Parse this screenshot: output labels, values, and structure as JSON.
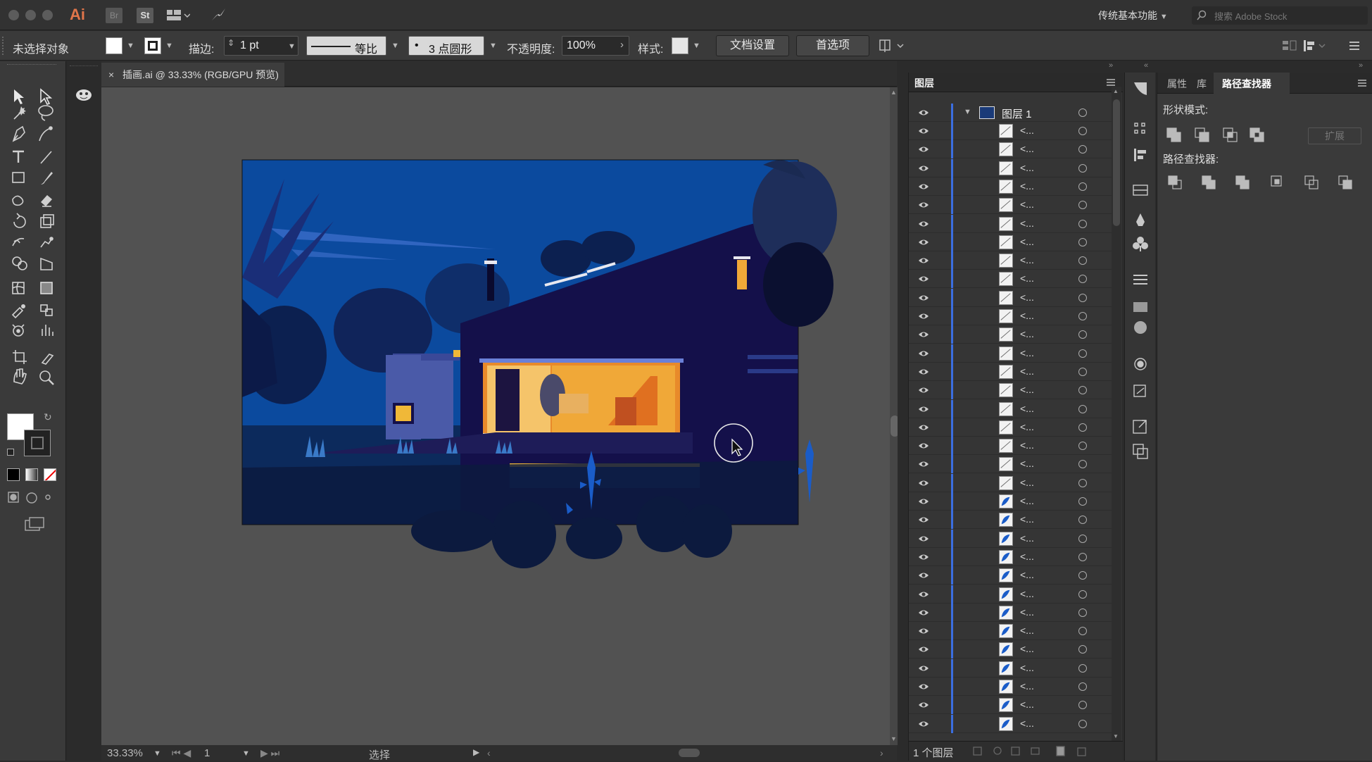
{
  "app": {
    "logo": "Ai",
    "bridge_label": "Br",
    "stock_label": "St"
  },
  "workspace": {
    "name": "传统基本功能",
    "search_placeholder": "搜索 Adobe Stock"
  },
  "control_bar": {
    "selection_status": "未选择对象",
    "stroke_label": "描边:",
    "stroke_weight": "1 pt",
    "profile_label": "等比",
    "brush_label": "3 点圆形",
    "opacity_label": "不透明度:",
    "opacity_value": "100%",
    "style_label": "样式:",
    "doc_setup": "文档设置",
    "preferences": "首选项"
  },
  "document": {
    "tab_title": "插画.ai @ 33.33% (RGB/GPU 预览)"
  },
  "status_bar": {
    "zoom": "33.33%",
    "artboard": "1",
    "tool_name": "选择"
  },
  "layers_panel": {
    "title": "图层",
    "top_layer": "图层 1",
    "sublayer_label": "<...",
    "footer_count": "1 个图层",
    "thumbs": [
      "w",
      "w",
      "w",
      "w",
      "w",
      "w",
      "w",
      "w",
      "w",
      "w",
      "w",
      "w",
      "w",
      "w",
      "w",
      "w",
      "w",
      "w",
      "w",
      "w",
      "b",
      "b",
      "b",
      "b",
      "b",
      "b",
      "b",
      "b",
      "b",
      "b",
      "b",
      "b",
      "b"
    ]
  },
  "right_panel": {
    "tabs": [
      "属性",
      "库",
      "路径查找器"
    ],
    "shape_modes_label": "形状模式:",
    "expand_label": "扩展",
    "pathfinders_label": "路径查找器:"
  },
  "colors": {
    "accent": "#3b6ee0",
    "sky": "#0b4a9e",
    "house": "#14104a",
    "window": "#f0a838"
  }
}
